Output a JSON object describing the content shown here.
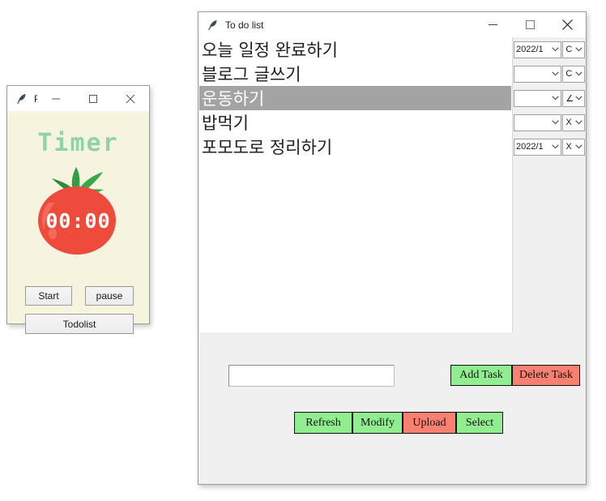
{
  "desktop": {
    "background": "#ffffff"
  },
  "todo_window": {
    "title": "To do list",
    "icon": "feather-icon",
    "controls": {
      "minimize": "minimize-icon",
      "maximize": "maximize-icon",
      "close": "close-icon"
    },
    "tasks": [
      {
        "text": "오늘 일정 완료하기",
        "selected": false,
        "date": "2022/1",
        "status": "C"
      },
      {
        "text": "블로그 글쓰기",
        "selected": false,
        "date": "",
        "status": "C"
      },
      {
        "text": "운동하기",
        "selected": true,
        "date": "",
        "status": "∠"
      },
      {
        "text": "밥먹기",
        "selected": false,
        "date": "",
        "status": "X"
      },
      {
        "text": "포모도로 정리하기",
        "selected": false,
        "date": "2022/1",
        "status": "X"
      }
    ],
    "entry": {
      "value": "",
      "placeholder": ""
    },
    "buttons": {
      "add_task": "Add Task",
      "delete_task": "Delete Task",
      "refresh": "Refresh",
      "modify": "Modify",
      "upload": "Upload",
      "select": "Select"
    },
    "colors": {
      "green": "#90ee90",
      "salmon": "#fa8072",
      "selection": "#a3a3a3",
      "panel": "#f0f0f0",
      "list_bg": "#ffffff"
    }
  },
  "timer_window": {
    "title": "P...",
    "icon": "feather-icon",
    "controls": {
      "minimize": "minimize-icon",
      "maximize": "maximize-icon",
      "close": "close-icon"
    },
    "heading": "Timer",
    "display": "00:00",
    "buttons": {
      "start": "Start",
      "pause": "pause",
      "todolist": "Todolist"
    },
    "colors": {
      "background": "#f6f4de",
      "heading": "#8fd3ab",
      "tomato_body": "#ef4b3c",
      "tomato_leaf": "#2f9e44",
      "digits": "#ffffff"
    }
  }
}
